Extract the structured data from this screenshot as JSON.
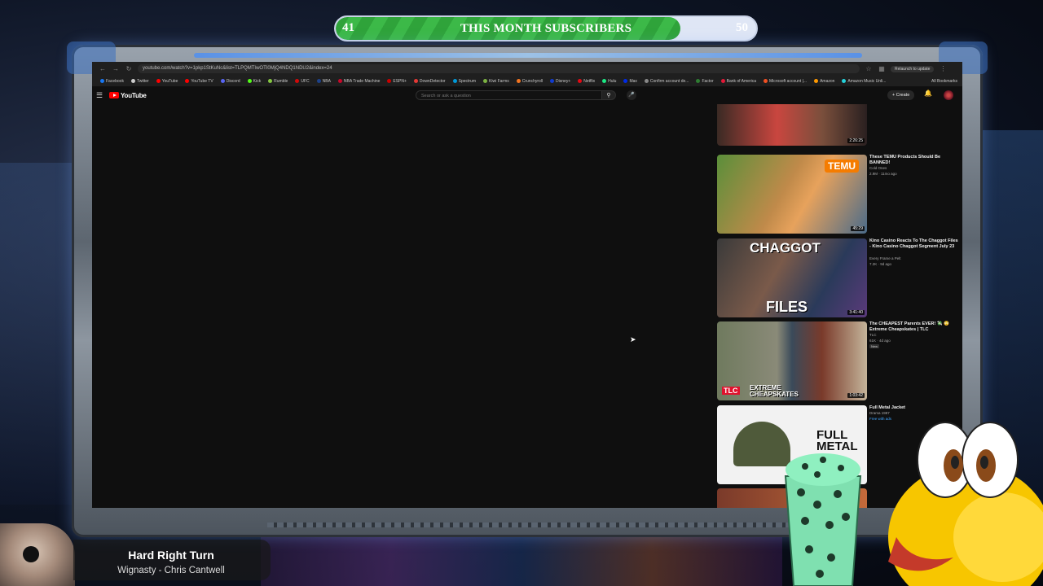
{
  "subgoal": {
    "current": "41",
    "label": "THIS MONTH SUBSCRIBERS",
    "goal": "50",
    "fill_fraction": 0.82
  },
  "browser": {
    "url": "youtube.com/watch?v=1pkp1StKuNc&list=TLPQMTIwOTI0MjQ4NDQ1NDU2&index=24",
    "relaunch_label": "Relaunch to update",
    "all_bookmarks": "All Bookmarks",
    "bookmarks": [
      {
        "label": "Facebook",
        "color": "#1877f2"
      },
      {
        "label": "Twitter",
        "color": "#cccccc"
      },
      {
        "label": "YouTube",
        "color": "#ff0000"
      },
      {
        "label": "YouTube TV",
        "color": "#ff0000"
      },
      {
        "label": "Discord",
        "color": "#5865f2"
      },
      {
        "label": "Kick",
        "color": "#53fc18"
      },
      {
        "label": "Rumble",
        "color": "#85c742"
      },
      {
        "label": "UFC",
        "color": "#d20a0a"
      },
      {
        "label": "NBA",
        "color": "#1d428a"
      },
      {
        "label": "NBA Trade Machine",
        "color": "#c9082a"
      },
      {
        "label": "ESPN+",
        "color": "#cc0000"
      },
      {
        "label": "DownDetector",
        "color": "#e53935"
      },
      {
        "label": "Spectrum",
        "color": "#0099d8"
      },
      {
        "label": "Kiwi Farms",
        "color": "#7cb342"
      },
      {
        "label": "Crunchyroll",
        "color": "#f47521"
      },
      {
        "label": "Disney+",
        "color": "#113ccf"
      },
      {
        "label": "Netflix",
        "color": "#e50914"
      },
      {
        "label": "Hulu",
        "color": "#1ce783"
      },
      {
        "label": "Max",
        "color": "#002be7"
      },
      {
        "label": "Confirm account de...",
        "color": "#888888"
      },
      {
        "label": "Factor",
        "color": "#2e7d32"
      },
      {
        "label": "Bank of America",
        "color": "#e31837"
      },
      {
        "label": "Microsoft account |...",
        "color": "#f25022"
      },
      {
        "label": "Amazon",
        "color": "#ff9900"
      },
      {
        "label": "Amazon Music Unli...",
        "color": "#25d1da"
      }
    ]
  },
  "youtube": {
    "logo_text": "YouTube",
    "search_placeholder": "Search or ask a question",
    "create_label": "Create"
  },
  "recommendations": [
    {
      "title": "",
      "channel": "",
      "meta": "",
      "duration": "2:26:25",
      "badge": ""
    },
    {
      "title": "These TEMU Products Should Be BANNED!",
      "channel": "Cold Ones",
      "meta": "2.9M · 11mo ago",
      "duration": "45:29",
      "badge": "",
      "thumb_text": "TEMU"
    },
    {
      "title": "Kino Casino Reacts To The Chaggot Files - Kino Casino Chaggot Segment July 23",
      "channel": "Every Frame a Pelt",
      "meta": "7.2K · 9d ago",
      "duration": "3:41:40",
      "badge": "",
      "thumb_text_top": "CHAGGOT",
      "thumb_text_bottom": "FILES"
    },
    {
      "title": "The CHEAPEST Parents EVER! 💸 😳 Extreme Cheapskates | TLC",
      "channel": "TLC",
      "meta": "61K · 4d ago",
      "duration": "1:03:42",
      "badge": "New",
      "thumb_text": "EXTREME CHEAPSKATES",
      "thumb_logo": "TLC"
    },
    {
      "title": "Full Metal Jacket",
      "channel": "Drama 1987",
      "meta": "Free with ads",
      "duration": "",
      "badge": "",
      "thumb_text": "FULL METAL"
    }
  ],
  "now_playing": {
    "title": "Hard Right Turn",
    "artist": "Wignasty - Chris Cantwell"
  },
  "colors": {
    "subgoal_fill": "#2fa33a",
    "yt_red": "#ff0000",
    "frame_glow": "#3f8bff"
  }
}
